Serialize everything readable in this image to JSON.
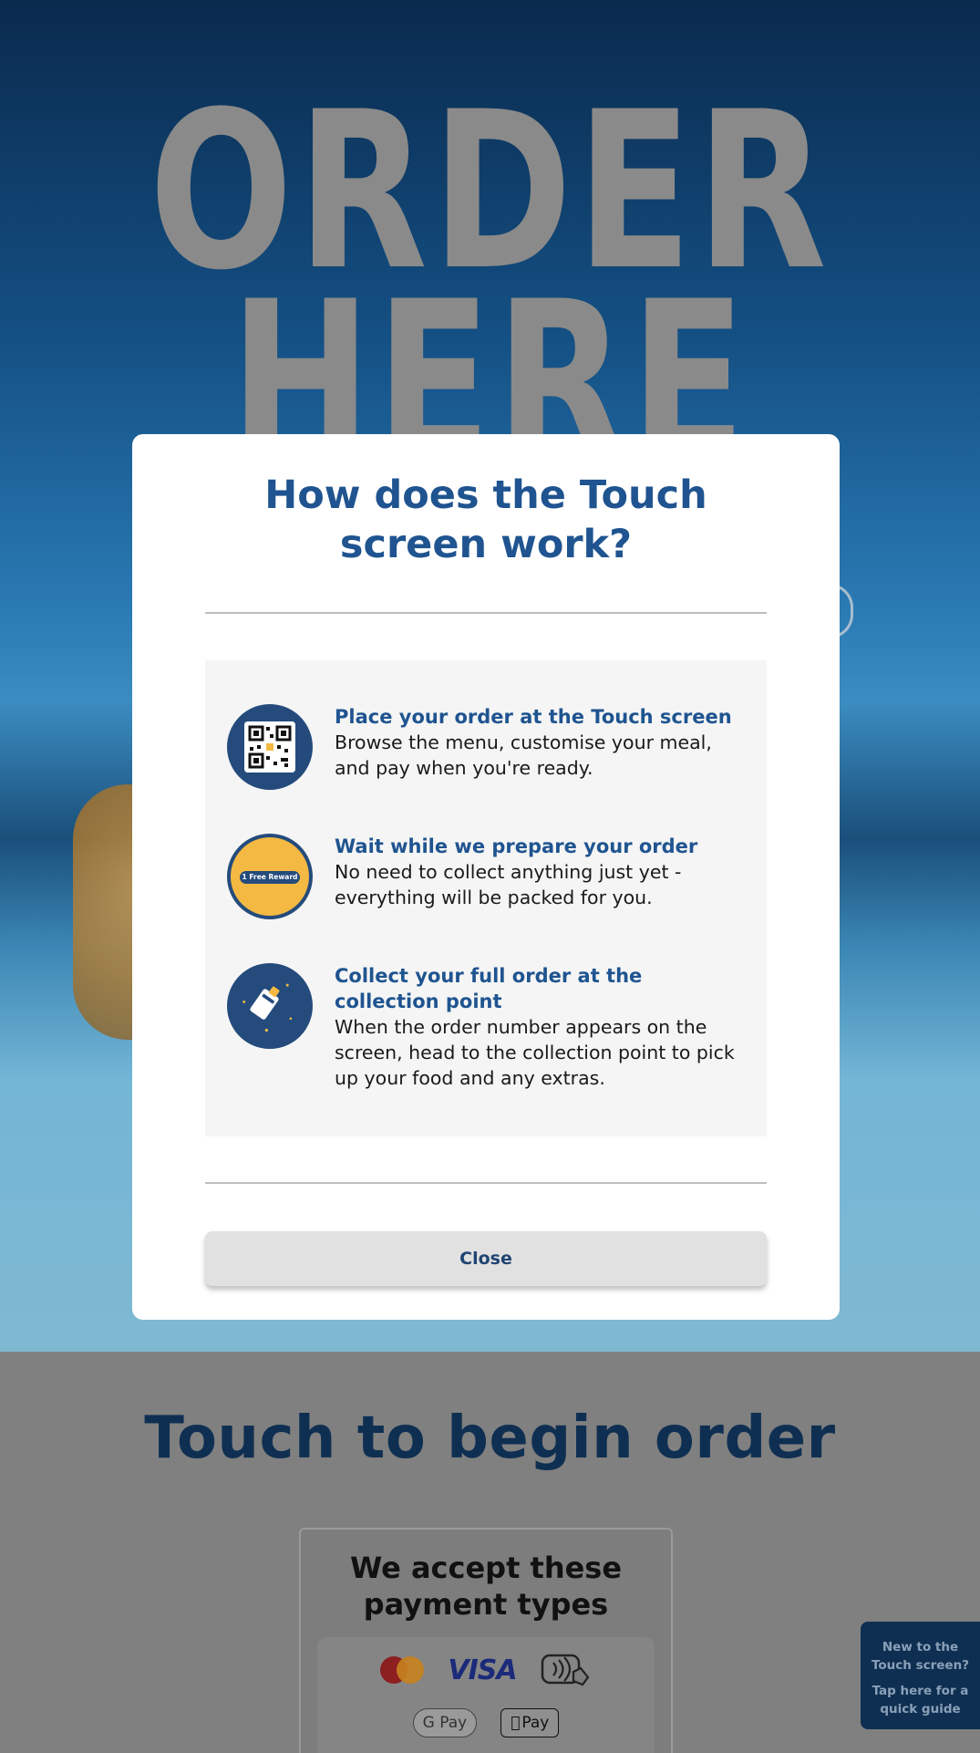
{
  "background": {
    "hero_line1": "ORDER",
    "hero_line2": "HERE",
    "touch_title": "Touch to begin order",
    "payment": {
      "title_line1": "We accept these",
      "title_line2": "payment types",
      "visa_label": "VISA",
      "gpay_label": "G Pay",
      "apay_label": "Pay"
    },
    "guide": {
      "line1": "New to the",
      "line2": "Touch screen?",
      "line3": "Tap here for a",
      "line4": "quick guide"
    }
  },
  "modal": {
    "title_line1": "How does the Touch",
    "title_line2": "screen work?",
    "steps": [
      {
        "heading": "Place your order at the Touch screen",
        "body": "Browse the menu, customise your meal, and pay when you're ready.",
        "icon": "qr-code-icon"
      },
      {
        "heading": "Wait while we prepare your order",
        "body": "No need to collect anything just yet - everything will be packed for you.",
        "icon": "reward-icon",
        "badge": "1 Free Reward"
      },
      {
        "heading": "Collect your full order at the collection point",
        "body": "When the order number appears on the screen, head to the collection point to pick up your food and any extras.",
        "icon": "receipt-icon"
      }
    ],
    "close_label": "Close"
  },
  "colors": {
    "brand_blue": "#1f5490",
    "navy": "#0f2f52",
    "reward_yellow": "#f4b942"
  }
}
